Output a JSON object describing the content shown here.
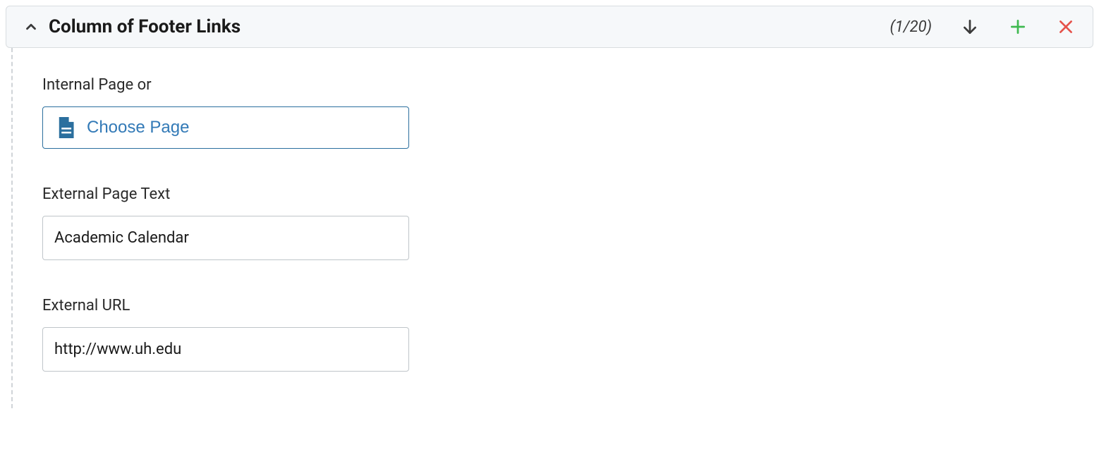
{
  "panel": {
    "title": "Column of Footer Links",
    "counter": "(1/20)"
  },
  "form": {
    "internal_page_label": "Internal Page or",
    "choose_page_label": "Choose Page",
    "external_text_label": "External Page Text",
    "external_text_value": "Academic Calendar",
    "external_url_label": "External URL",
    "external_url_value": "http://www.uh.edu"
  }
}
